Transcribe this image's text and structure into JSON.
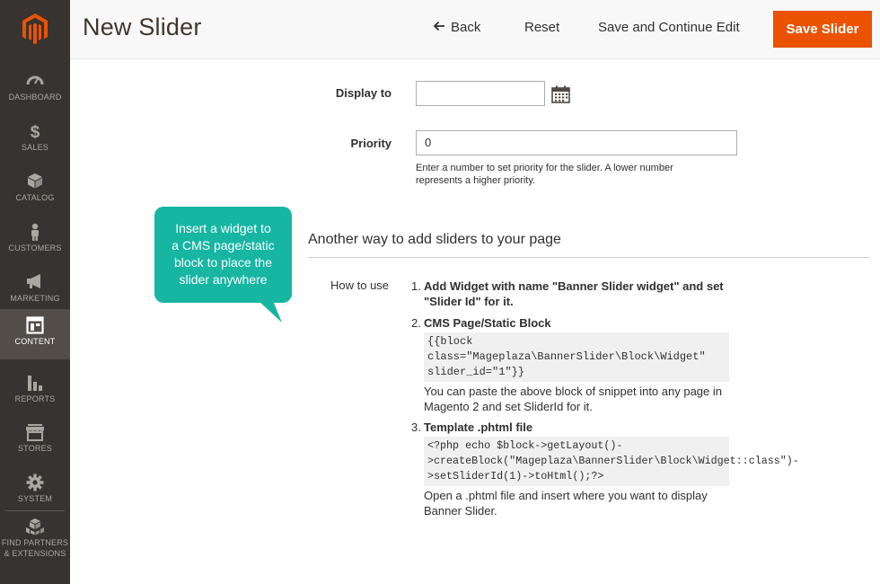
{
  "colors": {
    "sidebar": "#373330",
    "accent": "#eb5202",
    "callout": "#16b6a3",
    "active_nav": "#524d49"
  },
  "sidebar": {
    "logo_icon": "magento-logo-icon",
    "items": [
      {
        "label": "DASHBOARD",
        "icon": "dashboard-icon"
      },
      {
        "label": "SALES",
        "icon": "dollar-icon"
      },
      {
        "label": "CATALOG",
        "icon": "box-icon"
      },
      {
        "label": "CUSTOMERS",
        "icon": "person-icon"
      },
      {
        "label": "MARKETING",
        "icon": "megaphone-icon"
      },
      {
        "label": "CONTENT",
        "icon": "layout-icon",
        "active": true
      },
      {
        "label": "REPORTS",
        "icon": "bar-chart-icon"
      },
      {
        "label": "STORES",
        "icon": "store-icon"
      },
      {
        "label": "SYSTEM",
        "icon": "gear-icon"
      }
    ],
    "partners": {
      "line1": "FIND PARTNERS",
      "line2": "& EXTENSIONS",
      "icon": "cubes-icon"
    }
  },
  "header": {
    "title": "New Slider",
    "back_label": "Back",
    "reset_label": "Reset",
    "save_continue_label": "Save and Continue Edit",
    "save_label": "Save Slider"
  },
  "form": {
    "display_to": {
      "label": "Display to",
      "value": ""
    },
    "priority": {
      "label": "Priority",
      "value": "0",
      "note_line1": "Enter a number to set priority for the slider. A lower number",
      "note_line2": "represents a higher priority."
    }
  },
  "callout": {
    "line1": "Insert a widget to",
    "line2": "a CMS page/static",
    "line3": "block to place the",
    "line4": "slider anywhere"
  },
  "section": {
    "title": "Another way to add sliders to your page",
    "how_to_use_label": "How to use",
    "steps": [
      {
        "num": "1.",
        "title_line1": "Add Widget with name \"Banner Slider widget\" and set",
        "title_line2": "\"Slider Id\" for it."
      },
      {
        "num": "2.",
        "title": "CMS Page/Static Block",
        "code_line1": "{{block",
        "code_line2": "class=\"Mageplaza\\BannerSlider\\Block\\Widget\"",
        "code_line3": "slider_id=\"1\"}}",
        "desc_line1": "You can paste the above block of snippet into any page in",
        "desc_line2": "Magento 2 and set SliderId for it."
      },
      {
        "num": "3.",
        "title": "Template .phtml file",
        "code_line1": "<?php echo $block->getLayout()-",
        "code_line2": ">createBlock(\"Mageplaza\\BannerSlider\\Block\\Widget::class\")-",
        "code_line3": ">setSliderId(1)->toHtml();?>",
        "desc_line1": "Open a .phtml file and insert where you want to display",
        "desc_line2": "Banner Slider."
      }
    ]
  }
}
